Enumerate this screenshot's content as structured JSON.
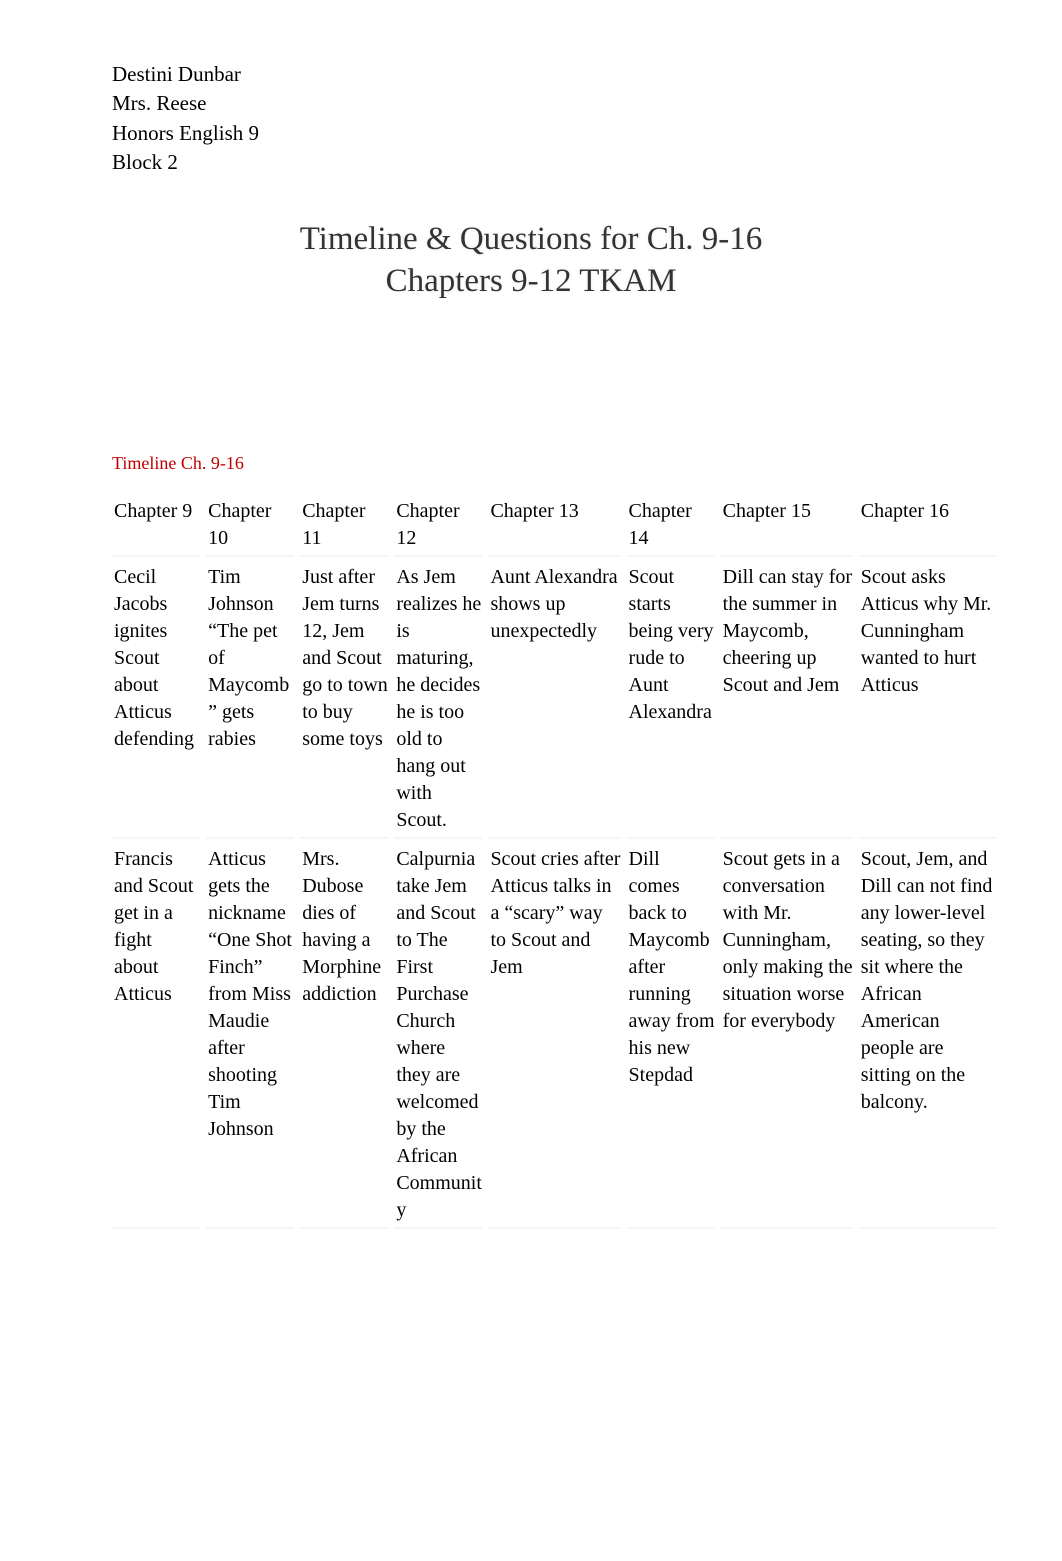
{
  "header": {
    "line1": "Destini Dunbar",
    "line2": "Mrs. Reese",
    "line3": "Honors English 9",
    "line4": "Block 2"
  },
  "title": {
    "line1": "Timeline & Questions for Ch. 9-16",
    "line2": "Chapters 9-12 TKAM"
  },
  "section_label": "Timeline Ch. 9-16",
  "table": {
    "headers": [
      "Chapter 9",
      "Chapter 10",
      "Chapter 11",
      "Chapter 12",
      "Chapter 13",
      "Chapter 14",
      "Chapter 15",
      "Chapter 16"
    ],
    "rows": [
      [
        "Cecil Jacobs ignites Scout about Atticus defending",
        "Tim Johnson “The pet of Maycomb” gets rabies",
        "Just after Jem turns 12, Jem and Scout go to town to buy some toys",
        "As Jem realizes he is maturing, he decides he is too old to hang out with Scout.",
        "Aunt Alexandra shows up unexpectedly",
        "Scout starts being very rude to Aunt Alexandra",
        "Dill can stay for the summer in Maycomb, cheering up Scout and Jem",
        "Scout asks Atticus why Mr. Cunningham wanted to hurt Atticus"
      ],
      [
        "Francis and Scout get in a fight about Atticus",
        "Atticus gets the nickname “One Shot Finch” from Miss Maudie after shooting Tim Johnson",
        "Mrs. Dubose dies of having a Morphine addiction",
        "Calpurnia take Jem and Scout to The First Purchase Church where they are welcomed by the African Community",
        "Scout cries after Atticus talks in a “scary” way to Scout and Jem",
        "Dill comes back to Maycomb after running away from his new Stepdad",
        "Scout gets in a conversation with Mr. Cunningham, only making the situation worse for everybody",
        "Scout, Jem, and Dill can not find any lower-level seating, so they sit where the African American people are sitting on the balcony."
      ]
    ]
  }
}
